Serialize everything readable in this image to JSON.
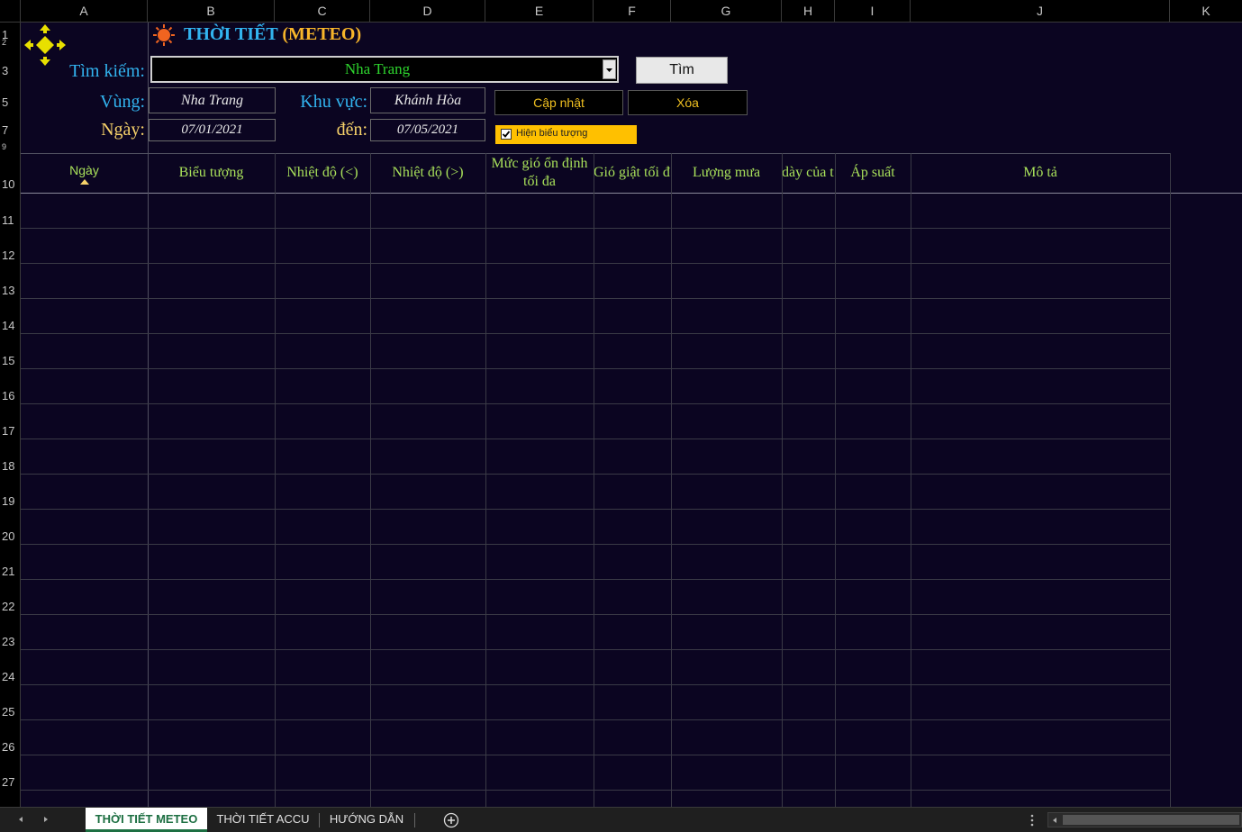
{
  "columns": [
    "A",
    "B",
    "C",
    "D",
    "E",
    "F",
    "G",
    "H",
    "I",
    "J",
    "K"
  ],
  "rows": [
    "1",
    "2",
    "3",
    "5",
    "7",
    "9",
    "10",
    "11",
    "12",
    "13",
    "14",
    "15",
    "16",
    "17",
    "18",
    "19",
    "20",
    "21",
    "22",
    "23",
    "24",
    "25",
    "26",
    "27"
  ],
  "title": {
    "prefix": "THỜI TIẾT",
    "suffix": "(METEO)"
  },
  "search": {
    "label": "Tìm kiếm:",
    "value": "Nha Trang",
    "button": "Tìm"
  },
  "region": {
    "label": "Vùng:",
    "value": "Nha Trang"
  },
  "area": {
    "label": "Khu vực:",
    "value": "Khánh Hòa"
  },
  "date": {
    "label": "Ngày:",
    "from": "07/01/2021",
    "to_label": "đến:",
    "to": "07/05/2021"
  },
  "buttons": {
    "update": "Cập nhật",
    "clear": "Xóa"
  },
  "show_icons": {
    "label": "Hiện biểu tượng",
    "checked": true
  },
  "table_headers": [
    "Ngày",
    "Biểu tượng",
    "Nhiệt độ (<)",
    "Nhiệt độ (>)",
    "Mức gió ổn định tối đa",
    "Gió giật tối đ",
    "Lượng mưa",
    "dày của t",
    "Áp suất",
    "Mô tả"
  ],
  "sheet_tabs": [
    "THỜI TIẾT METEO",
    "THỜI TIẾT ACCU",
    "HƯỚNG DẪN"
  ],
  "colors": {
    "background": "#0b0521",
    "header_text": "#a8e05a",
    "label_blue": "#32b4f0",
    "label_yellow": "#f7d26a",
    "accent": "#ffc000"
  }
}
